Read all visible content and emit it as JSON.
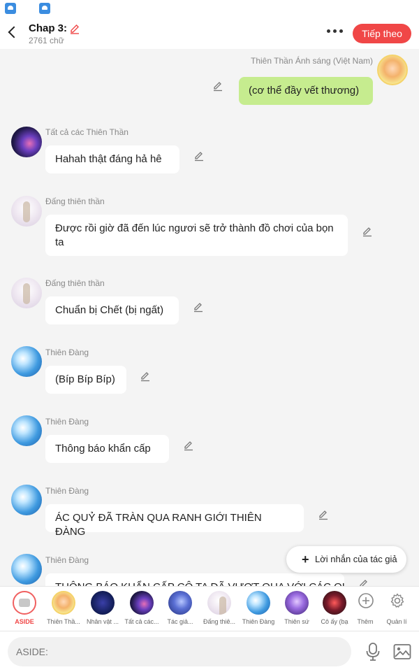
{
  "header": {
    "title": "Chap 3:",
    "word_count": "2761 chữ",
    "next_button": "Tiếp theo"
  },
  "messages": [
    {
      "sender": "Thiên Thần Ánh sáng (Việt Nam)",
      "text": "(cơ thể đầy vết thương)",
      "side": "right",
      "avatar": "anime-angel"
    },
    {
      "sender": "Tất cả các Thiên Thần",
      "text": "Hahah thật đáng hả hê",
      "side": "left",
      "avatar": "galaxy"
    },
    {
      "sender": "Đấng thiên thần",
      "text": "Được rồi giờ đã đến lúc ngươi sẽ trở thành đồ chơi của bọn ta",
      "side": "left",
      "avatar": "angel"
    },
    {
      "sender": "Đấng thiên thần",
      "text": "Chuẩn bị Chết (bị ngất)",
      "side": "left",
      "avatar": "angel"
    },
    {
      "sender": "Thiên Đàng",
      "text": "(Bíp Bíp Bíp)",
      "side": "left",
      "avatar": "sky"
    },
    {
      "sender": "Thiên Đàng",
      "text": "Thông báo khẩn cấp",
      "side": "left",
      "avatar": "sky"
    },
    {
      "sender": "Thiên Đàng",
      "text": "ÁC QUỶ ĐÃ TRÀN QUA RANH GIỚI THIÊN ĐÀNG",
      "side": "left",
      "avatar": "sky"
    },
    {
      "sender": "Thiên Đàng",
      "text": "THÔNG BÁO KHẨN CẤP CÔ TA ĐÃ VƯỢT QUA VỚI CÁC QUỶ",
      "side": "left",
      "avatar": "sky"
    }
  ],
  "floating_button": {
    "label": "Lời nhắn của tác giả"
  },
  "character_bar": {
    "aside_label": "ASIDE",
    "characters": [
      "Thiên Thầ...",
      "Nhân vật ...",
      "Tất cả các...",
      "Tác giả...",
      "Đấng thiê...",
      "Thiên Đàng",
      "Thiên sứ",
      "Cô ấy (bạ"
    ],
    "add_label": "Thêm",
    "manage_label": "Quản lí"
  },
  "input": {
    "placeholder": "ASIDE:"
  },
  "colors": {
    "accent": "#f04747",
    "bubble_self": "#c6ec8f",
    "bubble_other": "#ffffff",
    "background": "#f4f4f4"
  }
}
